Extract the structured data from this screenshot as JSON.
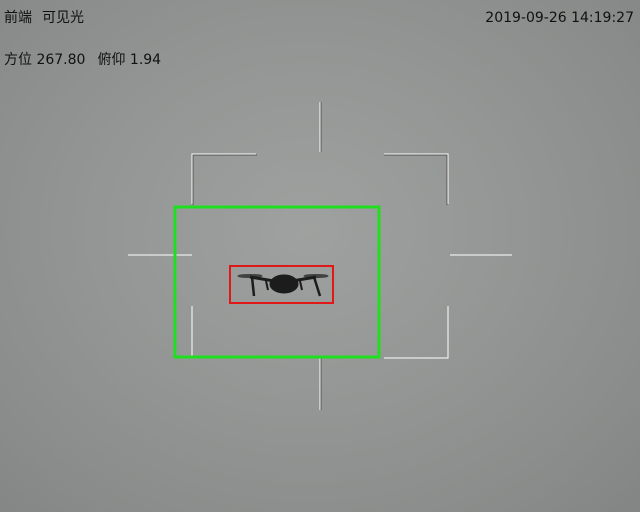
{
  "osd": {
    "camera_position": "前端",
    "camera_mode": "可见光",
    "azimuth_label": "方位",
    "azimuth_value": "267.80",
    "pitch_label": "俯仰",
    "pitch_value": "1.94",
    "timestamp": "2019-09-26 14:19:27"
  },
  "colors": {
    "track_box": "#1fe01f",
    "target_box": "#e01818",
    "reticle": "#ffffff",
    "text": "#111111"
  },
  "icons": {
    "target": "drone-icon"
  }
}
